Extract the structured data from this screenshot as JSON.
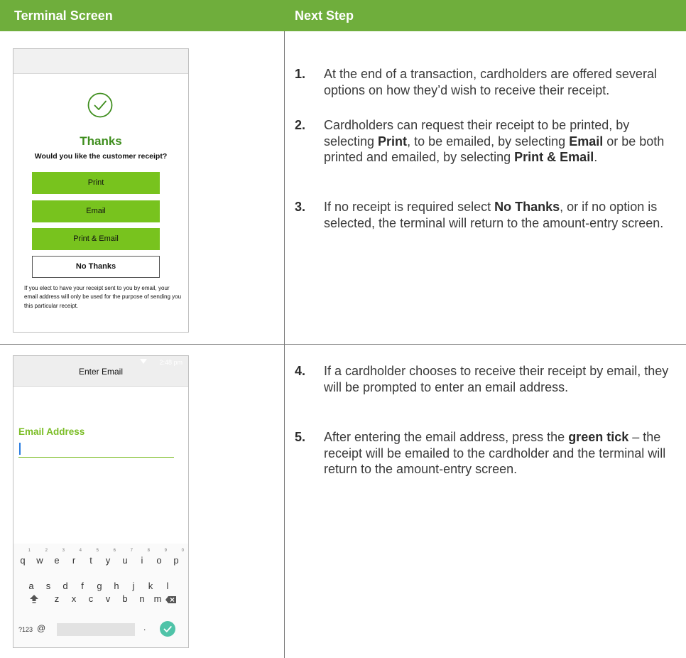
{
  "header": {
    "left": "Terminal Screen",
    "right": "Next Step"
  },
  "screen1": {
    "thanks": "Thanks",
    "question": "Would you like the customer receipt?",
    "buttons": {
      "print": "Print",
      "email": "Email",
      "print_email": "Print & Email",
      "no_thanks": "No Thanks"
    },
    "disclaimer": "If you elect to have your receipt sent to you by email, your email address will only be used for the purpose of sending you this particular receipt.",
    "icon": "check-circle-icon",
    "accent": "#3f8e1e",
    "button_color": "#78c31e"
  },
  "screen2": {
    "title": "Enter Email",
    "status_time": "2:48 pm",
    "field_label": "Email Address",
    "field_value": "",
    "keyboard": {
      "row1": [
        "q",
        "w",
        "e",
        "r",
        "t",
        "y",
        "u",
        "i",
        "o",
        "p"
      ],
      "row1_hints": [
        "1",
        "2",
        "3",
        "4",
        "5",
        "6",
        "7",
        "8",
        "9",
        "0"
      ],
      "row2": [
        "a",
        "s",
        "d",
        "f",
        "g",
        "h",
        "j",
        "k",
        "l"
      ],
      "row3": [
        "z",
        "x",
        "c",
        "v",
        "b",
        "n",
        "m"
      ],
      "symbols": "?123",
      "at": "@",
      "dot": ".",
      "shift_icon": "shift-icon",
      "backspace_icon": "backspace-icon",
      "enter_icon": "check-icon"
    }
  },
  "steps": [
    {
      "number": "1.",
      "segments": [
        {
          "t": "At the end of a transaction, cardholders are offered several options on how they’d wish to receive their receipt."
        }
      ]
    },
    {
      "number": "2.",
      "segments": [
        {
          "t": "Cardholders can request their receipt to be printed, by selecting "
        },
        {
          "t": "Print",
          "b": true
        },
        {
          "t": ", to be emailed, by selecting "
        },
        {
          "t": "Email",
          "b": true
        },
        {
          "t": " or be both printed and emailed, by selecting "
        },
        {
          "t": "Print & Email",
          "b": true
        },
        {
          "t": "."
        }
      ]
    },
    {
      "number": "3.",
      "segments": [
        {
          "t": "If no receipt is required select "
        },
        {
          "t": "No Thanks",
          "b": true
        },
        {
          "t": ", or if no option is selected, the terminal will return to the amount-entry screen."
        }
      ]
    },
    {
      "number": "4.",
      "segments": [
        {
          "t": "If a cardholder chooses to receive their receipt by email, they will be prompted to enter an email address."
        }
      ]
    },
    {
      "number": "5.",
      "segments": [
        {
          "t": "After entering the email address, press the "
        },
        {
          "t": "green tick",
          "b": true
        },
        {
          "t": " – the receipt will be emailed to the cardholder and the terminal will return to the amount-entry screen."
        }
      ]
    }
  ],
  "colors": {
    "header_bg": "#6fae3c",
    "label_green": "#7bbd26"
  }
}
